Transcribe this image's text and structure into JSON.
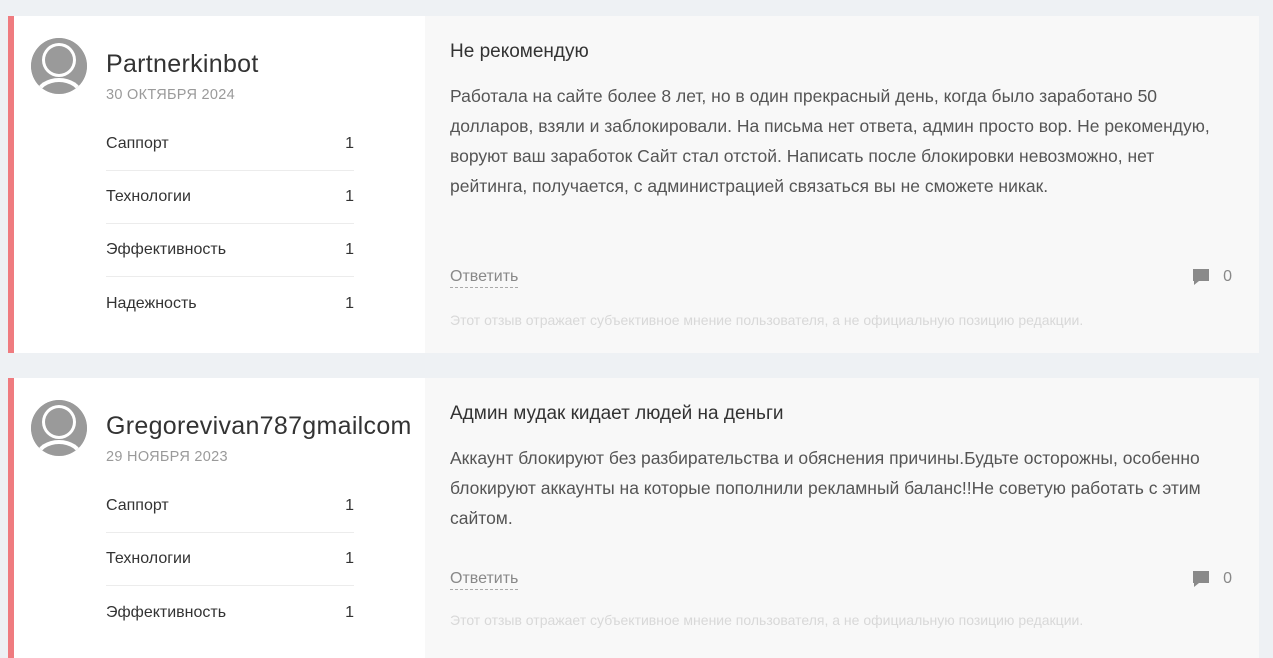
{
  "reviews": [
    {
      "username": "Partnerkinbot",
      "date": "30 ОКТЯБРЯ 2024",
      "ratings": [
        {
          "label": "Саппорт",
          "value": "1"
        },
        {
          "label": "Технологии",
          "value": "1"
        },
        {
          "label": "Эффективность",
          "value": "1"
        },
        {
          "label": "Надежность",
          "value": "1"
        }
      ],
      "title": "Не рекомендую",
      "text": "Работала на сайте более 8 лет, но в один прекрасный день, когда было заработано 50 долларов, взяли и заблокировали. На письма нет ответа, админ просто вор. Не рекомендую, воруют ваш заработок Сайт стал отстой. Написать после блокировки невозможно, нет рейтинга, получается, с администрацией связаться вы не сможете никак.",
      "reply_label": "Ответить",
      "comment_count": "0",
      "disclaimer": "Этот отзыв отражает субъективное мнение пользователя, а не официальную позицию редакции."
    },
    {
      "username": "Gregorevivan787gmailcom",
      "date": "29 НОЯБРЯ 2023",
      "ratings": [
        {
          "label": "Саппорт",
          "value": "1"
        },
        {
          "label": "Технологии",
          "value": "1"
        },
        {
          "label": "Эффективность",
          "value": "1"
        }
      ],
      "title": "Админ мудак кидает людей на деньги",
      "text": "Аккаунт блокируют без разбирательства и обяснения причины.Будьте осторожны, особенно блокируют аккаунты на которые пополнили рекламный баланс!!Не советую работать с этим сайтом.",
      "reply_label": "Ответить",
      "comment_count": "0",
      "disclaimer": "Этот отзыв отражает субъективное мнение пользователя, а не официальную позицию редакции."
    }
  ],
  "colors": {
    "accent_border": "#ef7b7f",
    "page_background": "#eef1f4"
  },
  "icons": {
    "avatar": "default-user-avatar-icon",
    "comments": "comment-bubble-icon"
  }
}
